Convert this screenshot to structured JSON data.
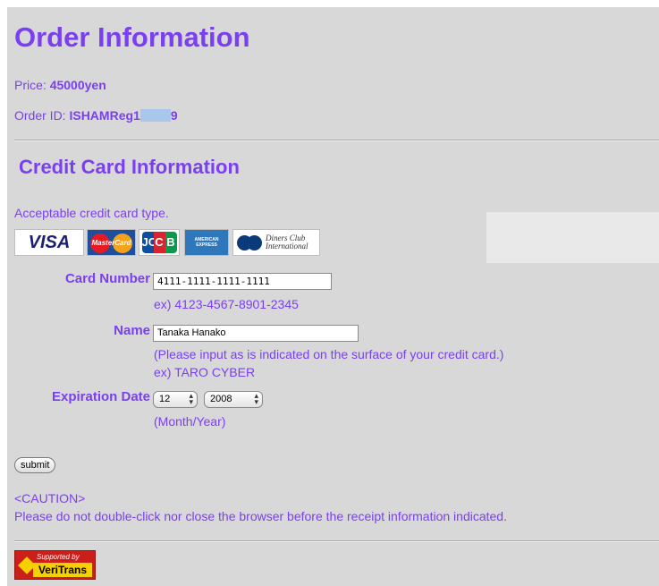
{
  "header": {
    "title": "Order Information",
    "price_label": "Price: ",
    "price_value": "45000yen",
    "order_id_label": "Order ID: ",
    "order_id_prefix": "ISHAMReg1",
    "order_id_suffix": "9"
  },
  "credit": {
    "section_title": "Credit Card Information",
    "acceptable_text": "Acceptable credit card type.",
    "cards": [
      {
        "name": "VISA"
      },
      {
        "name": "MasterCard"
      },
      {
        "name": "JCB"
      },
      {
        "name": "AMERICAN EXPRESS"
      },
      {
        "name": "Diners Club International"
      }
    ],
    "card_number_label": "Card Number",
    "card_number_value": "4111-1111-1111-1111",
    "card_number_example": "ex) 4123-4567-8901-2345",
    "name_label": "Name",
    "name_value": "Tanaka Hanako",
    "name_hint": "(Please input as is indicated on the surface of your credit card.)",
    "name_example": "ex) TARO CYBER",
    "expiration_label": "Expiration Date",
    "expiration_month": "12",
    "expiration_year": "2008",
    "expiration_hint": "(Month/Year)",
    "submit_label": "submit"
  },
  "caution": {
    "title": "<CAUTION>",
    "text": "Please do not double-click nor close the browser before the receipt information indicated."
  },
  "footer": {
    "badge_top": "Supported by",
    "badge_bottom": "VeriTrans"
  },
  "colors": {
    "accent": "#7b3ff2",
    "background": "#d8d8d8"
  }
}
